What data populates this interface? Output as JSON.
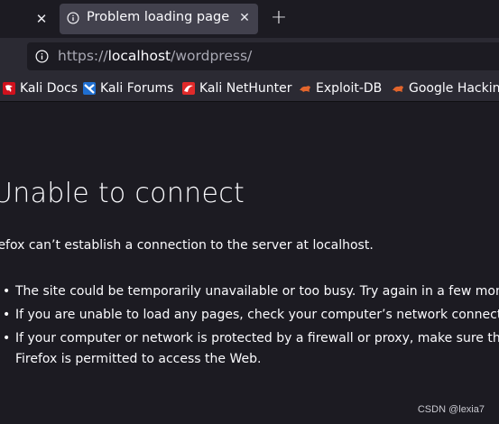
{
  "tabs": {
    "active_title": "Problem loading page",
    "close_glyph": "✕",
    "new_tab_glyph": "+"
  },
  "urlbar": {
    "prefix": "https://",
    "host": "localhost",
    "path": "/wordpress/"
  },
  "bookmarks": [
    {
      "label": "Kali Docs",
      "icon": "kali-docs-icon"
    },
    {
      "label": "Kali Forums",
      "icon": "kali-forums-icon"
    },
    {
      "label": "Kali NetHunter",
      "icon": "kali-nethunter-icon"
    },
    {
      "label": "Exploit-DB",
      "icon": "exploit-db-icon"
    },
    {
      "label": "Google Hacking",
      "icon": "google-hacking-icon"
    }
  ],
  "error": {
    "title": "Unable to connect",
    "description": "refox can’t establish a connection to the server at localhost.",
    "items": [
      "The site could be temporarily unavailable or too busy. Try again in a few moments.",
      "If you are unable to load any pages, check your computer’s network connection.",
      "If your computer or network is protected by a firewall or proxy, make sure that Firefox is permitted to access the Web."
    ],
    "bullet": "•"
  },
  "watermark": "CSDN @lexia7",
  "colors": {
    "background": "#1c1b22",
    "toolbar": "#2b2a33",
    "active_tab": "#42414d",
    "text": "#fbfbfe",
    "dim_text": "#a8a8b3"
  }
}
